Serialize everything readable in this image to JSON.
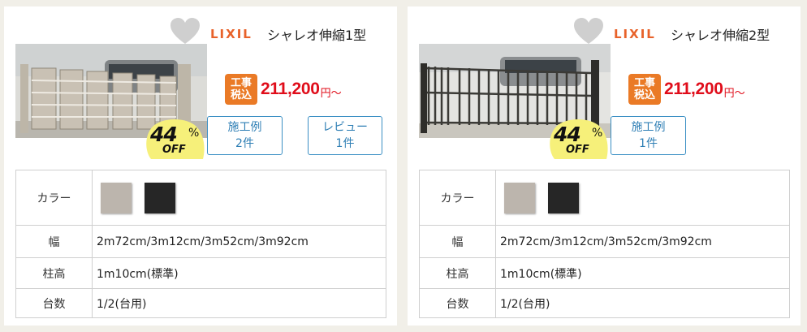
{
  "cards": [
    {
      "brand": "LIXIL",
      "title": "シャレオ伸縮1型",
      "tax_badge": [
        "工事",
        "税込"
      ],
      "price": "211,200",
      "price_suffix": "円〜",
      "discount_number": "44",
      "discount_symbol": "%",
      "discount_off": "OFF",
      "buttons": [
        {
          "line1": "施工例",
          "line2": "2件"
        },
        {
          "line1": "レビュー",
          "line2": "1件"
        }
      ],
      "specs": {
        "color_label": "カラー",
        "colors": [
          "#bcb5ad",
          "#262626"
        ],
        "width_label": "幅",
        "width_value": "2m72cm/3m12cm/3m52cm/3m92cm",
        "height_label": "柱高",
        "height_value": "1m10cm(標準)",
        "count_label": "台数",
        "count_value": "1/2(台用)"
      }
    },
    {
      "brand": "LIXIL",
      "title": "シャレオ伸縮2型",
      "tax_badge": [
        "工事",
        "税込"
      ],
      "price": "211,200",
      "price_suffix": "円〜",
      "discount_number": "44",
      "discount_symbol": "%",
      "discount_off": "OFF",
      "buttons": [
        {
          "line1": "施工例",
          "line2": "1件"
        }
      ],
      "specs": {
        "color_label": "カラー",
        "colors": [
          "#bcb5ad",
          "#262626"
        ],
        "width_label": "幅",
        "width_value": "2m72cm/3m12cm/3m52cm/3m92cm",
        "height_label": "柱高",
        "height_value": "1m10cm(標準)",
        "count_label": "台数",
        "count_value": "1/2(台用)"
      }
    }
  ],
  "colors": {
    "price": "#e00d1a",
    "tax_badge": "#ea7a26",
    "link_button": "#2f7fb5",
    "discount_circle": "#f6f07a",
    "brand": "#e8622a",
    "favorite": "#cfcfcf"
  },
  "icons": [
    "heart-icon"
  ]
}
